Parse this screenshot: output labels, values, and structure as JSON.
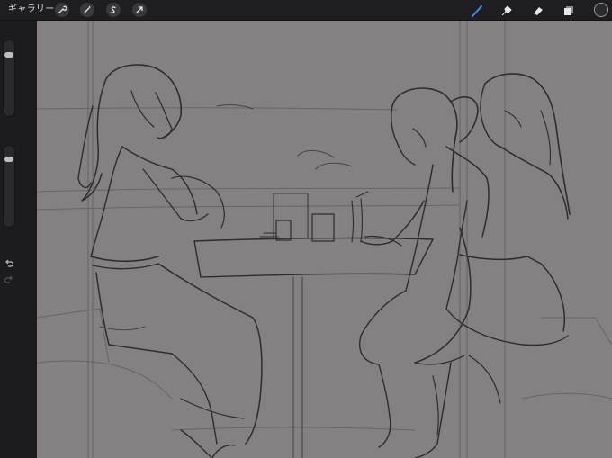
{
  "toolbar": {
    "gallery_label": "ギャラリー",
    "left_tools": [
      {
        "name": "wrench-icon",
        "label": "actions"
      },
      {
        "name": "magic-wand-icon",
        "label": "adjustments"
      },
      {
        "name": "selection-icon",
        "label": "selection"
      },
      {
        "name": "transform-arrow-icon",
        "label": "transform"
      }
    ],
    "right_tools": [
      "brush-icon",
      "smudge-icon",
      "eraser-icon",
      "layers-icon"
    ],
    "active_tool": "brush-icon",
    "current_color": "#2b2b2d"
  },
  "sidebar": {
    "brush_size_level": 0.8,
    "opacity_level": 0.9,
    "undo_icon": "undo-icon",
    "redo_icon": "redo-icon"
  },
  "canvas": {
    "background_color": "#858183",
    "sketch_color": "#2e2c2e"
  }
}
